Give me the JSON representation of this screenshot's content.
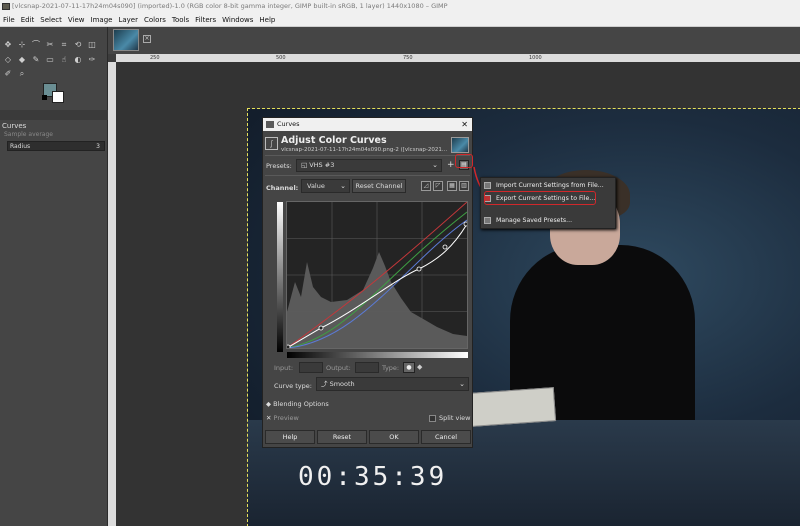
{
  "window": {
    "title": "[vlcsnap-2021-07-11-17h24m04s090] (imported)-1.0 (RGB color 8-bit gamma integer, GIMP built-in sRGB, 1 layer) 1440x1080 – GIMP"
  },
  "menubar": [
    "File",
    "Edit",
    "Select",
    "View",
    "Image",
    "Layer",
    "Colors",
    "Tools",
    "Filters",
    "Windows",
    "Help"
  ],
  "colors": {
    "foreground": "#6a8e93",
    "background": "#ffffff",
    "highlight": "#d0282b"
  },
  "tool_options": {
    "tool_name": "Curves",
    "sample_average": "Sample average",
    "radius_label": "Radius",
    "radius_value": "3"
  },
  "ruler": {
    "top_ticks": [
      "250",
      "500",
      "750",
      "1000"
    ]
  },
  "canvas": {
    "timecode": "00:35:39"
  },
  "curves_dialog": {
    "title": "Curves",
    "heading": "Adjust Color Curves",
    "subtitle": "vlcsnap-2021-07-11-17h24m04s090.png-2 ([vlcsnap-2021...",
    "presets_label": "Presets:",
    "preset_value": "VHS #3",
    "channel_label": "Channel:",
    "channel_value": "Value",
    "reset_channel": "Reset Channel",
    "input_label": "Input:",
    "output_label": "Output:",
    "type_label": "Type:",
    "curve_type_label": "Curve type:",
    "curve_type_value": "Smooth",
    "blending_options": "Blending Options",
    "preview": "Preview",
    "split_view": "Split view",
    "buttons": {
      "help": "Help",
      "reset": "Reset",
      "ok": "OK",
      "cancel": "Cancel"
    }
  },
  "context_menu": {
    "items": [
      "Import Current Settings from File...",
      "Export Current Settings to File...",
      "Manage Saved Presets..."
    ]
  }
}
